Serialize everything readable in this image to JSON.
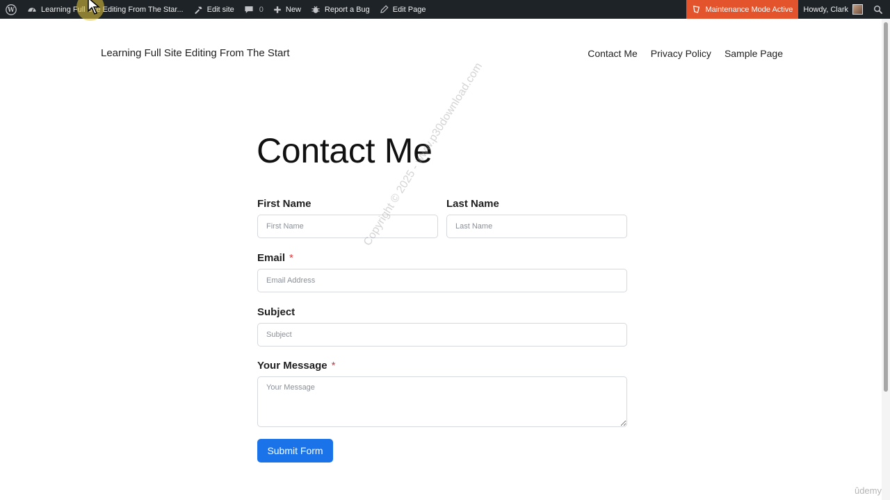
{
  "admin_bar": {
    "site_name": "Learning Full Site Editing From The Star...",
    "edit_site": "Edit site",
    "comments_count": "0",
    "new": "New",
    "report_bug": "Report a Bug",
    "edit_page": "Edit Page",
    "maintenance": "Maintenance Mode Active",
    "howdy": "Howdy, Clark"
  },
  "site": {
    "title": "Learning Full Site Editing From The Start",
    "nav": [
      "Contact Me",
      "Privacy Policy",
      "Sample Page"
    ]
  },
  "page": {
    "title": "Contact Me"
  },
  "form": {
    "first_name": {
      "label": "First Name",
      "placeholder": "First Name"
    },
    "last_name": {
      "label": "Last Name",
      "placeholder": "Last Name"
    },
    "email": {
      "label": "Email",
      "required": "*",
      "placeholder": "Email Address"
    },
    "subject": {
      "label": "Subject",
      "placeholder": "Subject"
    },
    "message": {
      "label": "Your Message",
      "required": "*",
      "placeholder": "Your Message"
    },
    "submit": "Submit Form"
  },
  "overlay": {
    "watermark": "Copyright © 2025 - www.p30download.com",
    "udemy": "ûdemy"
  },
  "colors": {
    "admin_bar": "#1d2327",
    "maintenance": "#e4542c",
    "submit": "#1a73e8",
    "required": "#d63638"
  }
}
